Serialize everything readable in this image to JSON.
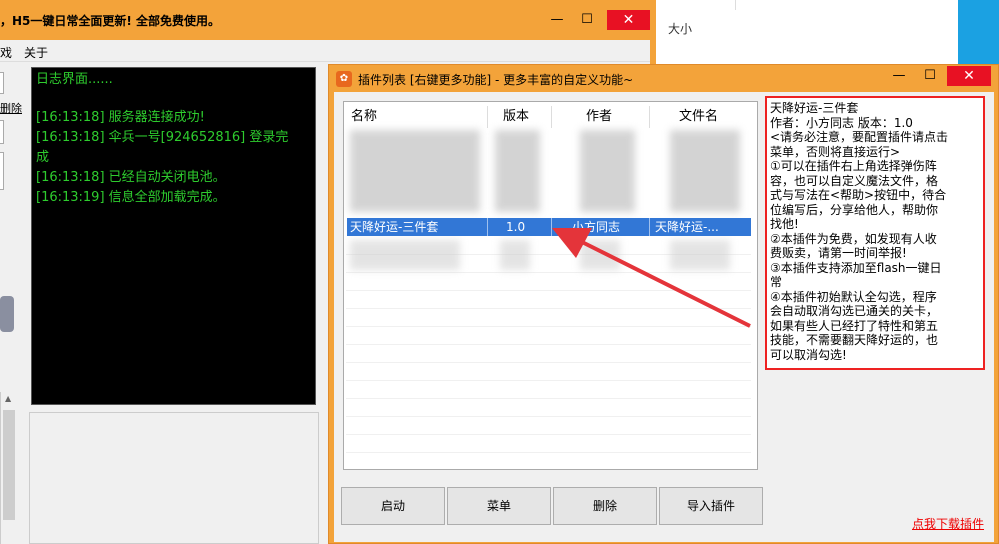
{
  "background": {
    "size_column_label": "大小"
  },
  "main_window": {
    "title": "，H5一键日常全面更新! 全部免费使用。",
    "minimize": "—",
    "maximize": "☐",
    "close": "✕",
    "menu": [
      "戏",
      "关于"
    ],
    "side_labels": [
      "删除"
    ],
    "log": {
      "title": "日志界面......",
      "lines": [
        "[16:13:18] 服务器连接成功!",
        "[16:13:18] 伞兵一号[924652816] 登录完",
        "成",
        "[16:13:18] 已经自动关闭电池。",
        "[16:13:19] 信息全部加载完成。"
      ]
    }
  },
  "plugin_window": {
    "title": "插件列表 [右键更多功能] - 更多丰富的自定义功能~",
    "minimize": "—",
    "maximize": "☐",
    "close": "✕",
    "list": {
      "columns": [
        "名称",
        "版本",
        "作者",
        "文件名"
      ],
      "selected_row": {
        "name": "天降好运-三件套",
        "version": "1.0",
        "author": "小方同志",
        "file": "天降好运-..."
      }
    },
    "description_lines": [
      "天降好运-三件套",
      "作者：小方同志   版本：1.0",
      "<请务必注意，要配置插件请点击",
      "菜单，否则将直接运行>",
      "①可以在插件右上角选择弹伤阵",
      "容，也可以自定义魔法文件，格",
      "式与写法在<帮助>按钮中，待合",
      "位编写后，分享给他人，帮助你",
      "找他!",
      "②本插件为免费，如发现有人收",
      "费贩卖，请第一时间举报!",
      "③本插件支持添加至flash一键日",
      "常",
      "④本插件初始默认全勾选，程序",
      "会自动取消勾选已通关的关卡，",
      "如果有些人已经打了特性和第五",
      "技能，不需要翻天降好运的，也",
      "可以取消勾选!"
    ],
    "buttons": {
      "start": "启动",
      "menu": "菜单",
      "delete": "删除",
      "import": "导入插件"
    },
    "download_link": "点我下载插件"
  },
  "colors": {
    "window_frame": "#f3a33a",
    "close_red": "#e81123",
    "selection_blue": "#3277d6",
    "log_green": "#2ecc2e",
    "highlight_border": "#e22"
  }
}
